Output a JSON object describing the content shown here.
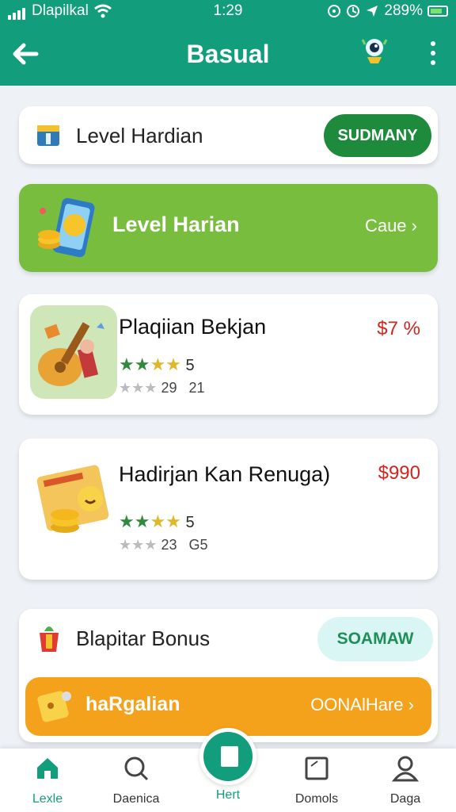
{
  "status": {
    "carrier": "Dlapilkal",
    "time": "1:29",
    "battery": "289%"
  },
  "header": {
    "title": "Basual",
    "back_icon": "arrow-left-icon",
    "profile_icon": "robot-avatar-icon",
    "menu_icon": "more-vertical-icon",
    "background": "#129d7d"
  },
  "daily_level": {
    "label": "Level Hardian",
    "button": "SUDMANY"
  },
  "green_banner": {
    "label": "Level Harian",
    "action": "Caue"
  },
  "products": [
    {
      "name": "Plaqiian Bekjan",
      "price": "$7 %",
      "stars": "★★★★",
      "count": "5",
      "meta_stars": "★★★",
      "meta1": "29",
      "meta2": "21"
    },
    {
      "name": "Hadirjan Kan Renuga)",
      "price": "$990",
      "stars": "★★★★",
      "count": "5",
      "meta_stars": "★★★",
      "meta1": "23",
      "meta2": "G5"
    }
  ],
  "bonus": {
    "label": "Blapitar Bonus",
    "button": "SOAMAW",
    "bar_label": "haRgalian",
    "bar_action": "OONAlHare"
  },
  "nav": {
    "items": [
      {
        "label": "Lexle",
        "icon": "home-icon"
      },
      {
        "label": "Daenica",
        "icon": "search-icon"
      },
      {
        "label": "Hert",
        "icon": "document-icon"
      },
      {
        "label": "Domols",
        "icon": "square-icon"
      },
      {
        "label": "Daga",
        "icon": "user-icon"
      }
    ]
  }
}
